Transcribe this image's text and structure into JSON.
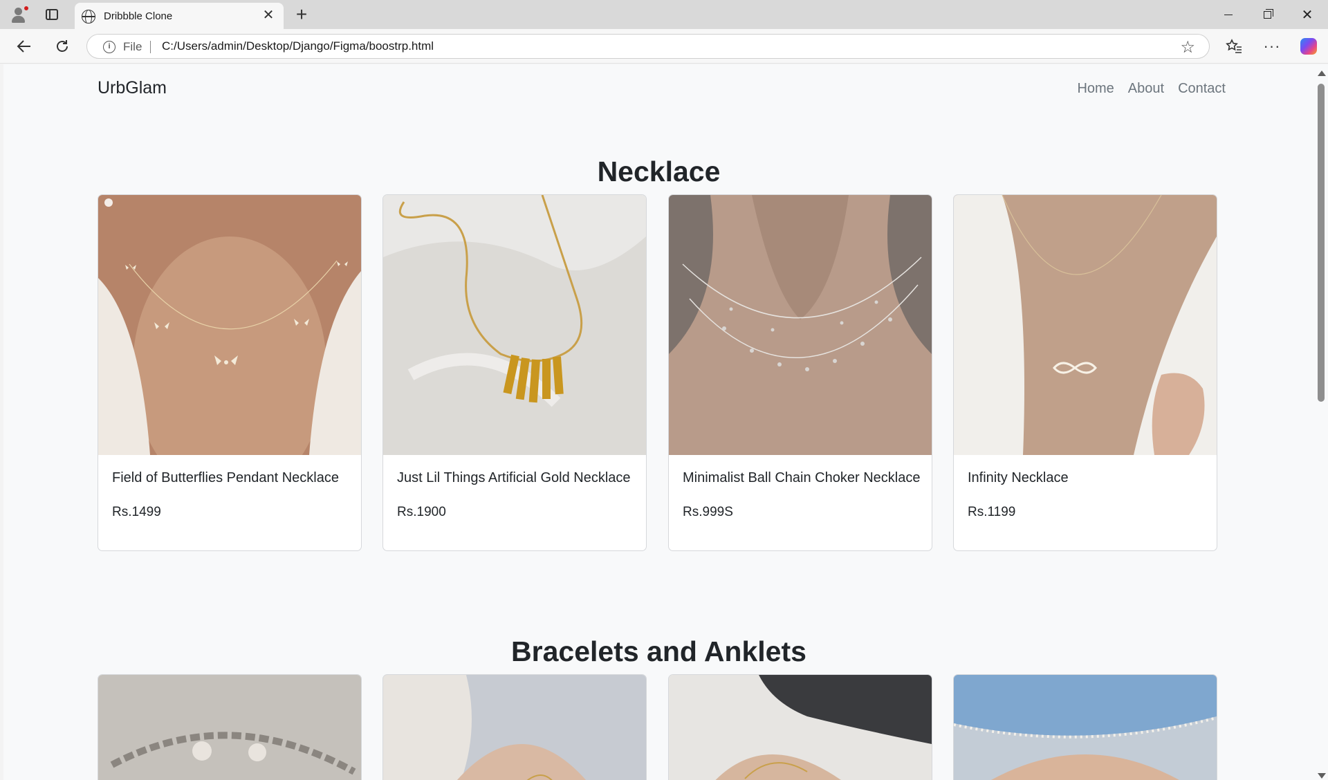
{
  "browser": {
    "tab_title": "Dribbble Clone",
    "address_prefix": "File",
    "url": "C:/Users/admin/Desktop/Django/Figma/boostrp.html"
  },
  "site": {
    "brand": "UrbGlam",
    "nav": [
      "Home",
      "About",
      "Contact"
    ]
  },
  "sections": [
    {
      "title": "Necklace",
      "products": [
        {
          "name": "Field of Butterflies Pendant Necklace",
          "price": "Rs.1499"
        },
        {
          "name": "Just Lil Things Artificial Gold Necklace",
          "price": "Rs.1900"
        },
        {
          "name": "Minimalist Ball Chain Choker Necklace",
          "price": "Rs.999S"
        },
        {
          "name": "Infinity Necklace",
          "price": "Rs.1199"
        }
      ]
    },
    {
      "title": "Bracelets and Anklets"
    }
  ]
}
